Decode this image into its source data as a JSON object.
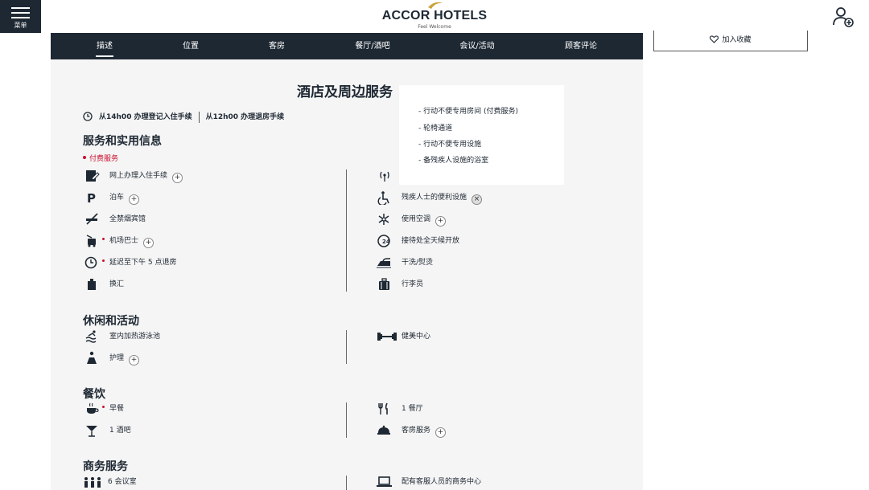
{
  "header": {
    "menu_label": "菜单",
    "brand": "ACCOR HOTELS",
    "tagline": "Feel Welcome",
    "brand_color": "#1e2833",
    "accent_color": "#c8a43a"
  },
  "nav": {
    "tabs": [
      {
        "label": "描述",
        "active": true
      },
      {
        "label": "位置"
      },
      {
        "label": "客房"
      },
      {
        "label": "餐厅/酒吧"
      },
      {
        "label": "会议/活动"
      },
      {
        "label": "顾客评论"
      }
    ]
  },
  "favorite_label": "加入收藏",
  "page_title": "酒店及周边服务",
  "checkin_text": "从14h00 办理登记入住手续",
  "checkout_text": "从12h00 办理退房手续",
  "paid_legend": "付费服务",
  "paid_color": "#c8102e",
  "sections": {
    "services": {
      "title": "服务和实用信息",
      "left": [
        {
          "label": "网上办理入住手续",
          "icon": "online-checkin-icon",
          "plus": true
        },
        {
          "label": "泊车",
          "icon": "parking-icon",
          "plus": true
        },
        {
          "label": "全禁烟宾馆",
          "icon": "no-smoking-icon"
        },
        {
          "label": "机场巴士",
          "icon": "airport-bus-icon",
          "plus": true,
          "paid": true
        },
        {
          "label": "延迟至下午 5 点退房",
          "icon": "late-checkout-icon",
          "paid": true
        },
        {
          "label": "换汇",
          "icon": "currency-exchange-icon"
        }
      ],
      "right": [
        {
          "label": "",
          "icon": "wifi-icon"
        },
        {
          "label": "残疾人士的便利设施",
          "icon": "wheelchair-icon",
          "plus": true,
          "open": true
        },
        {
          "label": "使用空调",
          "icon": "air-conditioning-icon",
          "plus": true
        },
        {
          "label": "接待处全天候开放",
          "icon": "reception-24h-icon"
        },
        {
          "label": "干洗/熨烫",
          "icon": "laundry-iron-icon"
        },
        {
          "label": "行李员",
          "icon": "luggage-icon"
        }
      ]
    },
    "leisure": {
      "title": "休闲和活动",
      "left": [
        {
          "label": "室内加热游泳池",
          "icon": "pool-icon"
        },
        {
          "label": "护理",
          "icon": "spa-icon",
          "plus": true
        }
      ],
      "right": [
        {
          "label": "健美中心",
          "icon": "fitness-icon"
        }
      ]
    },
    "dining": {
      "title": "餐饮",
      "left": [
        {
          "label": "早餐",
          "icon": "breakfast-icon",
          "paid": true
        },
        {
          "label": "1 酒吧",
          "icon": "bar-icon"
        }
      ],
      "right": [
        {
          "label": "1 餐厅",
          "icon": "restaurant-icon"
        },
        {
          "label": "客房服务",
          "icon": "room-service-icon",
          "plus": true
        }
      ]
    },
    "business": {
      "title": "商务服务",
      "left": [
        {
          "label": "6 会议室",
          "icon": "meeting-room-icon"
        }
      ],
      "right": [
        {
          "label": "配有客服人员的商务中心",
          "icon": "business-center-icon"
        }
      ]
    }
  },
  "popover": {
    "lines": [
      "- 行动不便专用房间 (付费服务)",
      "- 轮椅通道",
      "- 行动不便专用设施",
      "- 备残疾人设施的浴室"
    ]
  }
}
